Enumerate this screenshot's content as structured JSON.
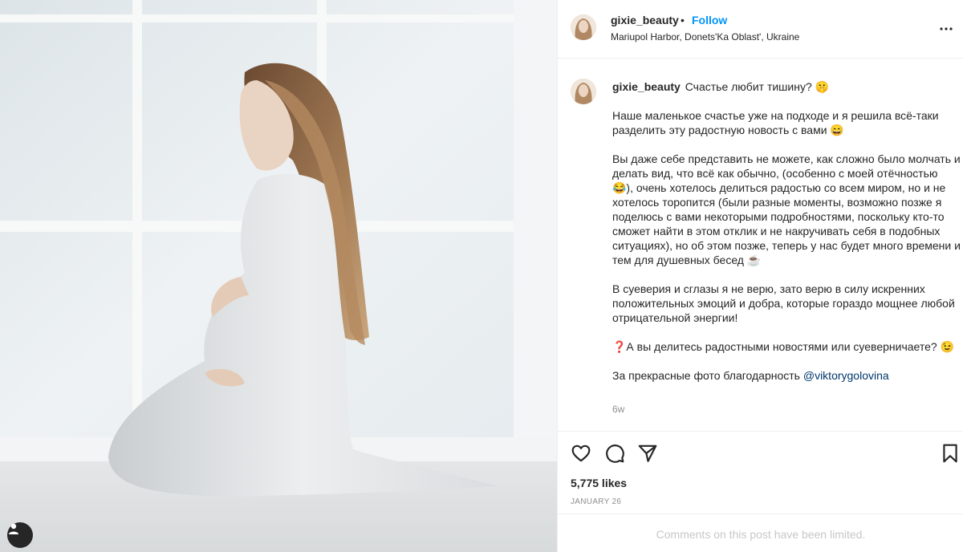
{
  "post": {
    "image_alt": "Pregnant woman in white dress kneeling by a bright window"
  },
  "header": {
    "username": "gixie_beauty",
    "dot": "•",
    "follow_label": "Follow",
    "location": "Mariupol Harbor, Donets'Ka Oblast', Ukraine"
  },
  "caption": {
    "username": "gixie_beauty",
    "title": "Счастье любит тишину? 🤫",
    "p1": "Наше маленькое счастье уже на подходе и я решила всё-таки разделить эту радостную новость с вами 😄",
    "p2": "Вы даже себе представить не можете, как сложно было молчать и делать вид, что всё как обычно, (особенно с моей отёчностью 😂), очень хотелось делиться радостью со всем миром, но и не хотелось торопится (были разные моменты, возможно позже я поделюсь с вами некоторыми подробностями, поскольку кто-то сможет найти в этом отклик и не накручивать себя в подобных ситуациях), но об этом позже, теперь у нас будет много времени и тем для душевных бесед ☕",
    "p3": "В суеверия и сглазы я не верю, зато верю в силу искренних положительных эмоций и добра, которые гораздо мощнее любой отрицательной энергии!",
    "p4": "❓А вы делитесь радостными новостями или суеверничаете? 😉",
    "p5_prefix": "За прекрасные фото благодарность ",
    "mention": "@viktorygolovina",
    "time_ago": "6w"
  },
  "actions": {
    "like_icon": "heart-icon",
    "comment_icon": "comment-icon",
    "share_icon": "paper-plane-icon",
    "save_icon": "bookmark-icon"
  },
  "likes": "5,775 likes",
  "date": "January 26",
  "comments_notice": "Comments on this post have been limited."
}
